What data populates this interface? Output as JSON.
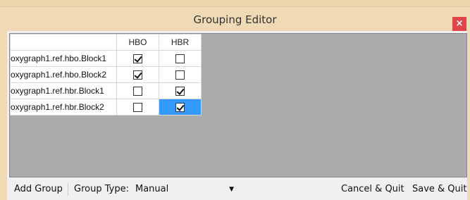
{
  "window": {
    "title": "Grouping Editor",
    "close_glyph": "×"
  },
  "grid": {
    "columns": [
      "HBO",
      "HBR"
    ],
    "rows": [
      {
        "label": "oxygraph1.ref.hbo.Block1",
        "checks": [
          true,
          false
        ]
      },
      {
        "label": "oxygraph1.ref.hbo.Block2",
        "checks": [
          true,
          false
        ]
      },
      {
        "label": "oxygraph1.ref.hbr.Block1",
        "checks": [
          false,
          true
        ]
      },
      {
        "label": "oxygraph1.ref.hbr.Block2",
        "checks": [
          false,
          true
        ]
      }
    ],
    "selected_cell": {
      "row": 3,
      "col": 1
    }
  },
  "toolbar": {
    "add_group": "Add Group",
    "group_type_label": "Group Type:",
    "group_type_value": "Manual",
    "cancel_quit": "Cancel & Quit",
    "save_quit": "Save & Quit"
  },
  "colors": {
    "selection": "#3399ff",
    "close": "#e0454a",
    "grid_bg": "#ababab"
  }
}
